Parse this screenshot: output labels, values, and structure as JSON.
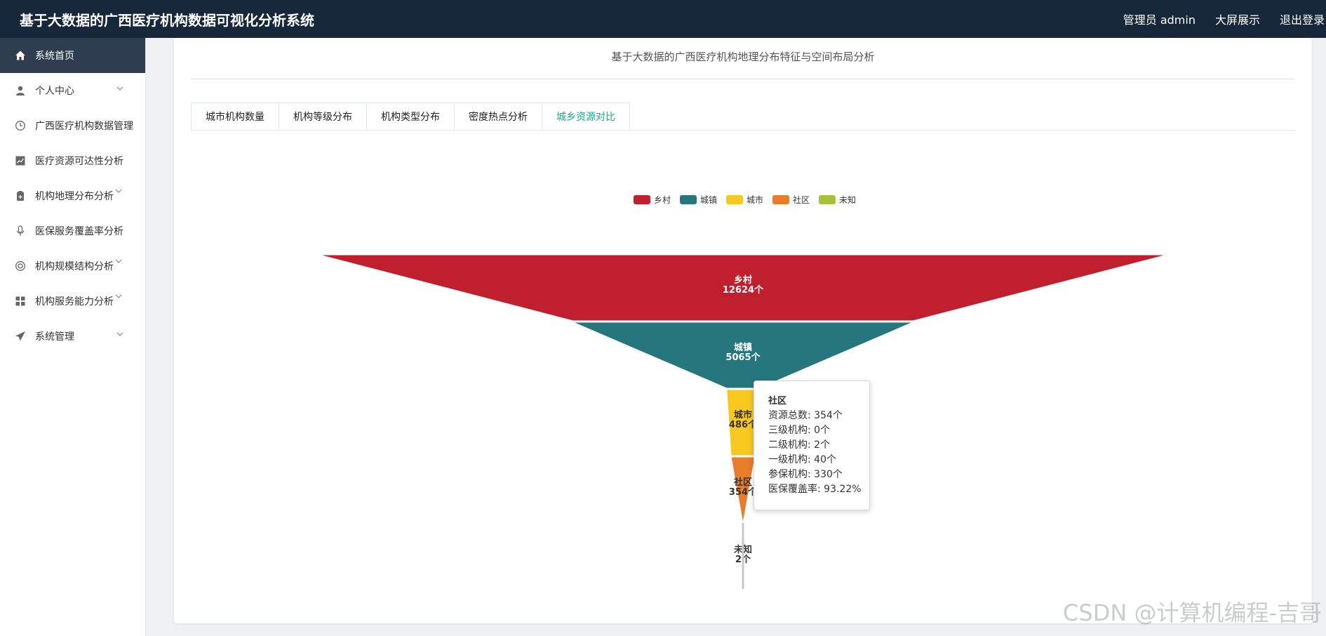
{
  "header": {
    "app_title": "基于大数据的广西医疗机构数据可视化分析系统",
    "admin_label": "管理员 admin",
    "big_screen_label": "大屏展示",
    "logout_label": "退出登录"
  },
  "sidebar": {
    "items": [
      {
        "label": "系统首页",
        "icon": "home-icon",
        "active": true
      },
      {
        "label": "个人中心",
        "icon": "user-icon"
      },
      {
        "label": "广西医疗机构数据管理",
        "icon": "clock-icon"
      },
      {
        "label": "医疗资源可达性分析",
        "icon": "trend-icon"
      },
      {
        "label": "机构地理分布分析",
        "icon": "clipboard-icon"
      },
      {
        "label": "医保服务覆盖率分析",
        "icon": "microphone-icon"
      },
      {
        "label": "机构规模结构分析",
        "icon": "lifebuoy-icon"
      },
      {
        "label": "机构服务能力分析",
        "icon": "grid-icon"
      },
      {
        "label": "系统管理",
        "icon": "send-icon"
      }
    ]
  },
  "panel": {
    "title": "基于大数据的广西医疗机构地理分布特征与空间布局分析",
    "tabs": [
      {
        "label": "城市机构数量"
      },
      {
        "label": "机构等级分布"
      },
      {
        "label": "机构类型分布"
      },
      {
        "label": "密度热点分析"
      },
      {
        "label": "城乡资源对比",
        "active": true
      }
    ]
  },
  "chart_data": {
    "type": "funnel",
    "categories": [
      "乡村",
      "城镇",
      "城市",
      "社区",
      "未知"
    ],
    "values": [
      12624,
      5065,
      486,
      354,
      2
    ],
    "unit": "个",
    "labels": [
      "12624个",
      "5065个",
      "486个",
      "354个",
      "2个"
    ],
    "colors": [
      "#c0202d",
      "#26767e",
      "#f7c81f",
      "#e87d2b",
      "#a8c13a"
    ],
    "legend_position": "top-center"
  },
  "tooltip": {
    "title": "社区",
    "lines": [
      "资源总数: 354个",
      "三级机构: 0个",
      "二级机构: 2个",
      "一级机构: 40个",
      "参保机构: 330个",
      "医保覆盖率: 93.22%"
    ]
  },
  "watermark": "CSDN @计算机编程-吉哥"
}
